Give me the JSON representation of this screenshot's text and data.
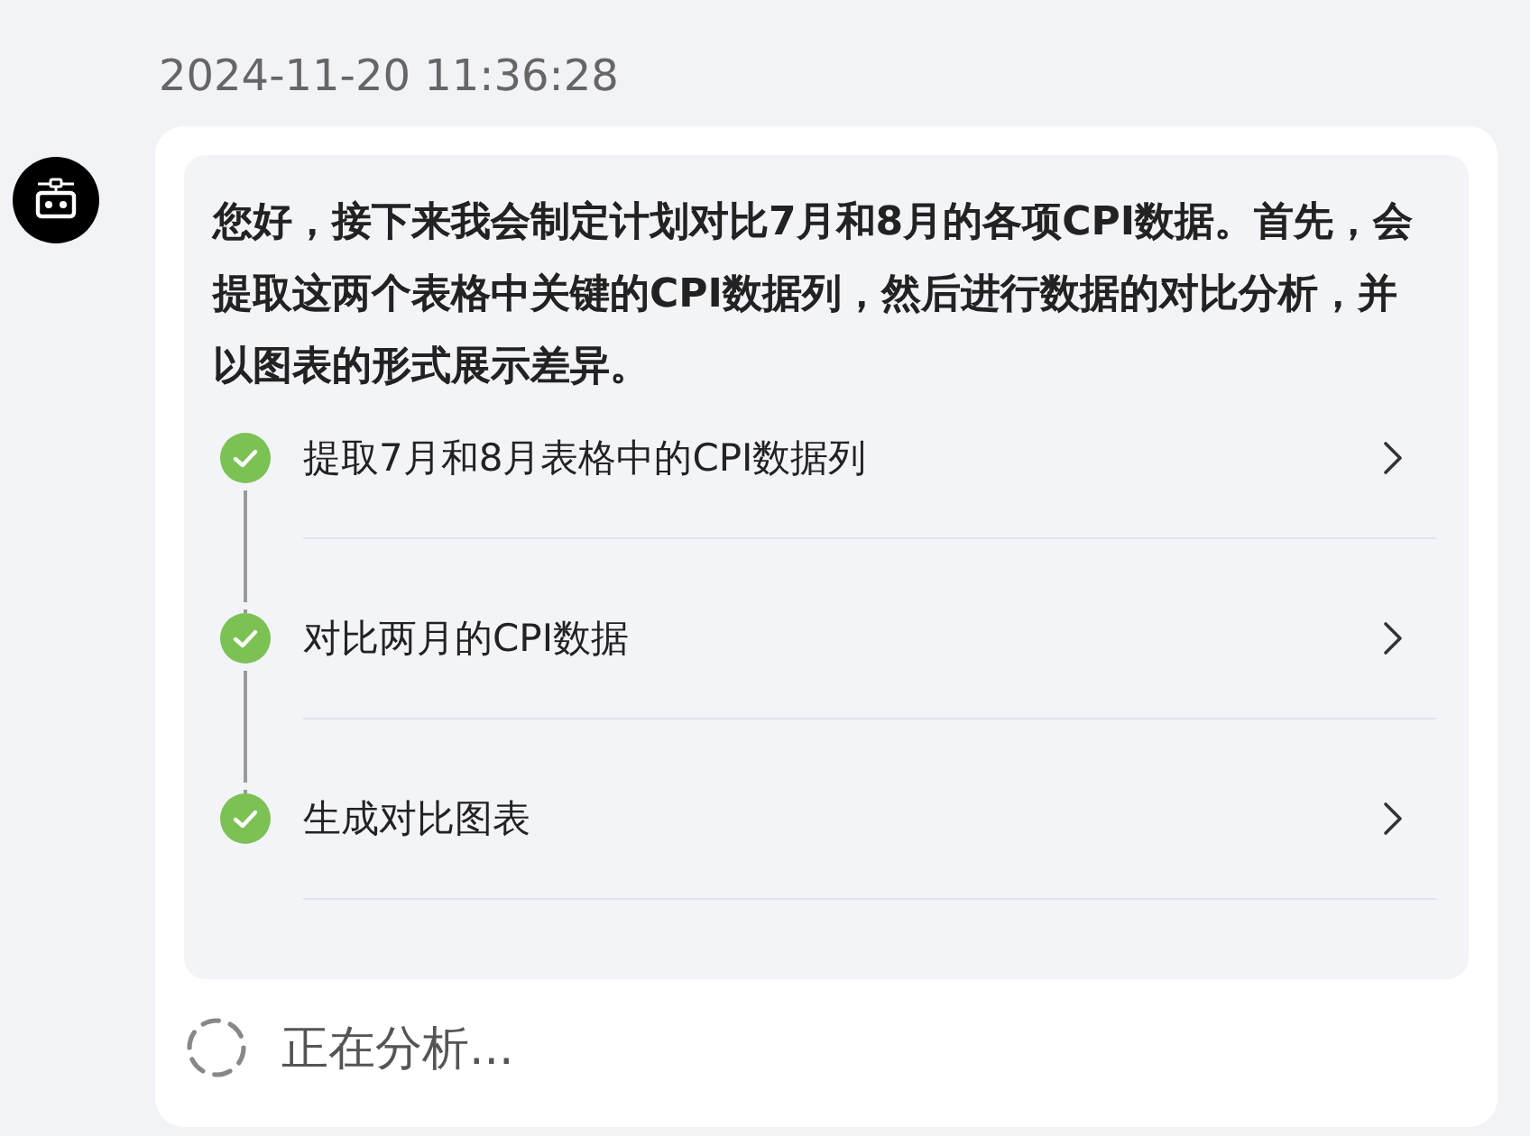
{
  "timestamp": "2024-11-20 11:36:28",
  "message": {
    "text": "您好，接下来我会制定计划对比7月和8月的各项CPI数据。首先，会提取这两个表格中关键的CPI数据列，然后进行数据的对比分析，并以图表的形式展示差异。",
    "steps": [
      {
        "label": "提取7月和8月表格中的CPI数据列",
        "done": true
      },
      {
        "label": "对比两月的CPI数据",
        "done": true
      },
      {
        "label": "生成对比图表",
        "done": true
      }
    ]
  },
  "status_line": {
    "text": "正在分析...",
    "loading": true
  }
}
